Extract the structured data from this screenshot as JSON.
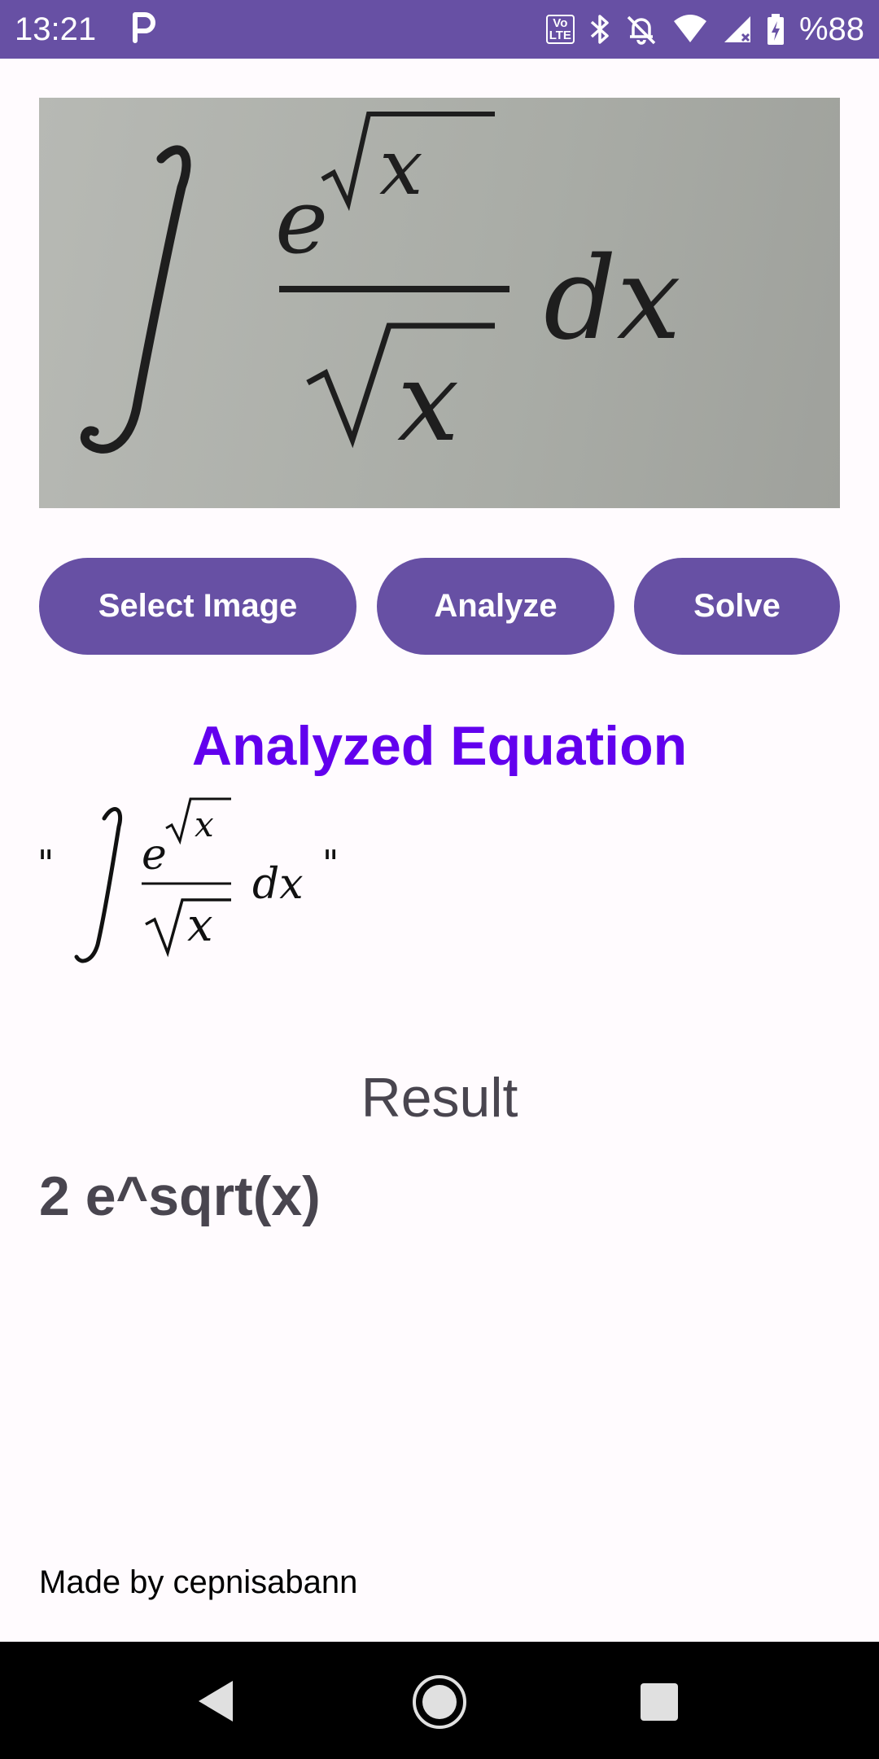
{
  "status_bar": {
    "time": "13:21",
    "notification_icon": "p-icon",
    "lte_label": "Vo LTE",
    "battery_text": "%88",
    "bg_color": "#6750a4"
  },
  "photo": {
    "description_icon": "equation-photo"
  },
  "buttons": {
    "select_image": "Select Image",
    "analyze": "Analyze",
    "solve": "Solve"
  },
  "analyzed": {
    "title": "Analyzed Equation",
    "open_quote": "\"",
    "close_quote": "\"",
    "dx": "dx",
    "exp_base": "e",
    "var": "x",
    "title_color": "#6200ee"
  },
  "result": {
    "title": "Result",
    "value": "2 e^sqrt(x)"
  },
  "footer": {
    "text": "Made by cepnisabann"
  }
}
